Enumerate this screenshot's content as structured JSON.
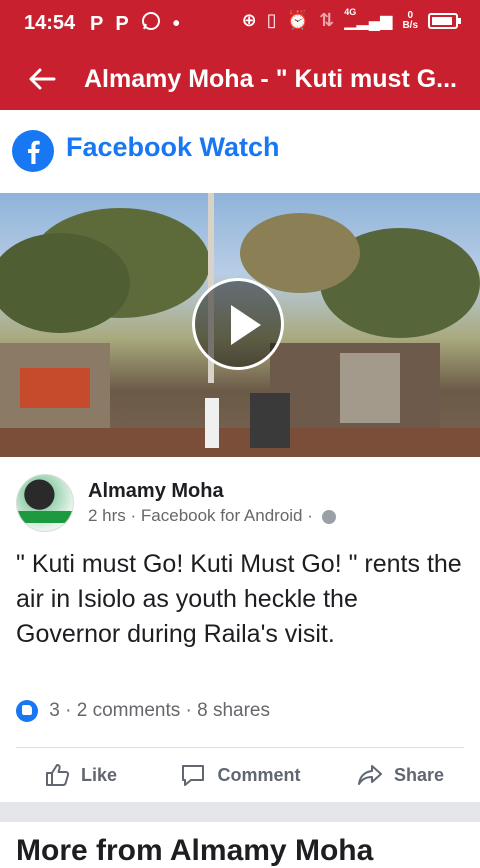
{
  "status_bar": {
    "time": "14:54",
    "notif_icons": [
      "p-icon",
      "p-icon",
      "whatsapp-icon",
      "dot-icon"
    ],
    "network_type": "4G",
    "data_rate_value": "0",
    "data_rate_unit": "B/s",
    "battery_level": 0.9
  },
  "app_bar": {
    "title": "Almamy Moha - \" Kuti must G..."
  },
  "section": {
    "title": "Facebook Watch"
  },
  "post": {
    "author": "Almamy Moha",
    "meta": "2 hrs · Facebook for Android ·",
    "text": "\" Kuti must Go! Kuti Must Go! \" rents the air in Isiolo as youth heckle the Governor during Raila's visit.",
    "reaction_count": "3",
    "comments": "2 comments",
    "shares": "8 shares",
    "separator": "·"
  },
  "actions": {
    "like": "Like",
    "comment": "Comment",
    "share": "Share"
  },
  "more_from": "More from Almamy Moha",
  "colors": {
    "brand_red": "#c8202f",
    "facebook_blue": "#1877f2"
  }
}
